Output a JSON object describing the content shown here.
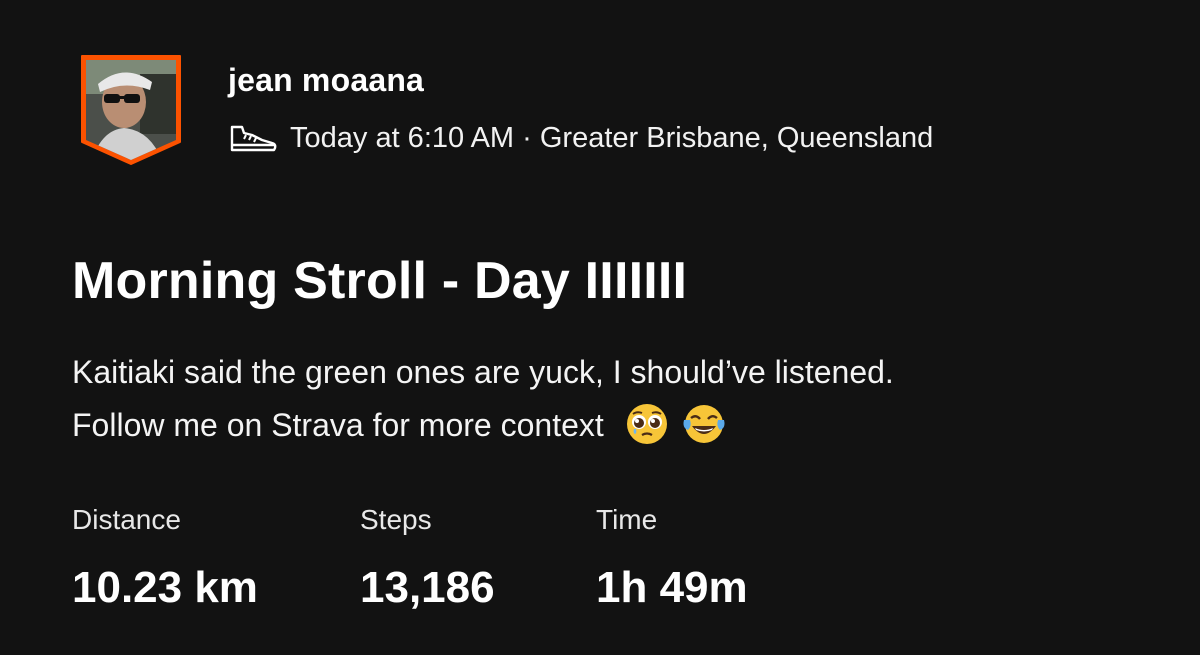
{
  "user": {
    "name": "jean moaana",
    "activity_icon": "walking-shoe-icon",
    "timestamp": "Today at 6:10 AM",
    "separator": " · ",
    "location": "Greater Brisbane, Queensland",
    "avatar_border_color": "#fc5200"
  },
  "activity": {
    "title": "Morning Stroll - Day IIIIIII",
    "description_line1": "Kaitiaki said the green ones are yuck, I should’ve listened.",
    "description_line2": "Follow me on Strava for more context",
    "emojis": [
      "pleading-face-icon",
      "tears-of-joy-icon"
    ]
  },
  "stats": [
    {
      "label": "Distance",
      "value": "10.23 km"
    },
    {
      "label": "Steps",
      "value": "13,186"
    },
    {
      "label": "Time",
      "value": "1h 49m"
    }
  ]
}
